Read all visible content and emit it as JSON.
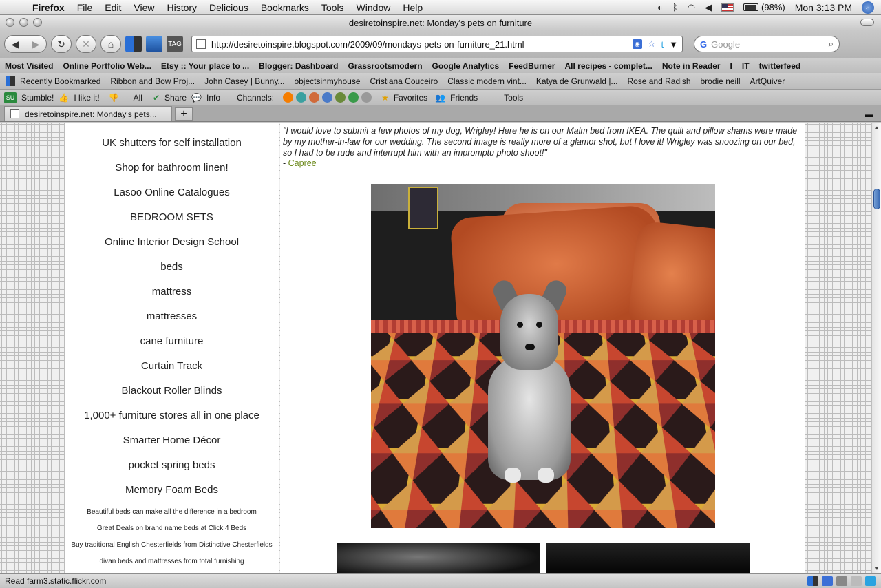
{
  "menubar": {
    "app": "Firefox",
    "items": [
      "File",
      "Edit",
      "View",
      "History",
      "Delicious",
      "Bookmarks",
      "Tools",
      "Window",
      "Help"
    ],
    "battery": "(98%)",
    "clock": "Mon 3:13 PM"
  },
  "window": {
    "title": "desiretoinspire.net: Monday's pets on furniture"
  },
  "navbar": {
    "url": "http://desiretoinspire.blogspot.com/2009/09/mondays-pets-on-furniture_21.html",
    "search_placeholder": "Google",
    "tag_label": "TAG"
  },
  "bookmarks_row1": [
    "Most Visited",
    "Online Portfolio Web...",
    "Etsy :: Your place to ...",
    "Blogger: Dashboard",
    "Grassrootsmodern",
    "Google Analytics",
    "FeedBurner",
    "All recipes - complet...",
    "Note in Reader",
    "I",
    "IT",
    "twitterfeed"
  ],
  "bookmarks_row2": [
    "Recently Bookmarked",
    "Ribbon and Bow Proj...",
    "John Casey | Bunny...",
    "objectsinmyhouse",
    "Cristiana Couceiro",
    "Classic modern vint...",
    "Katya de Grunwald |...",
    "Rose and Radish",
    "brodie neill",
    "ArtQuiver"
  ],
  "stumble_bar": {
    "su_icon": "SU",
    "stumble": "Stumble!",
    "like": "I like it!",
    "all": "All",
    "share": "Share",
    "info": "Info",
    "channels": "Channels:",
    "favorites": "Favorites",
    "friends": "Friends",
    "tools": "Tools"
  },
  "tabs": [
    {
      "label": "desiretoinspire.net: Monday's pets..."
    }
  ],
  "new_tab": "+",
  "sidebar": {
    "links_big": [
      "UK shutters for self installation",
      "Shop for bathroom linen!",
      "Lasoo Online Catalogues",
      "BEDROOM SETS",
      "Online Interior Design School",
      "beds",
      "mattress",
      "mattresses",
      "cane furniture",
      "Curtain Track",
      "Blackout Roller Blinds",
      "1,000+ furniture stores all in one place",
      "Smarter Home Décor",
      "pocket spring beds",
      "Memory Foam Beds"
    ],
    "links_small": [
      "Beautiful beds can make all the difference in a bedroom",
      "Great Deals on brand name beds at Click 4 Beds",
      "Buy traditional English Chesterfields from Distinctive Chesterfields",
      "divan beds and mattresses from total furnishing"
    ]
  },
  "post": {
    "quote": "\"I would love to submit a few photos of my dog, Wrigley! Here he is on our Malm bed from IKEA. The quilt and pillow shams were made by my mother-in-law for our wedding. The second image is really more of a glamor shot, but I love it! Wrigley was snoozing on our bed, so I had to be rude and interrupt him with an impromptu photo shoot!\"",
    "attrib_prefix": "- ",
    "author": "Capree"
  },
  "status": {
    "text": "Read farm3.static.flickr.com"
  },
  "colors": {
    "link_green": "#6d8a1c",
    "scroll_thumb": "#3a6bb5"
  }
}
